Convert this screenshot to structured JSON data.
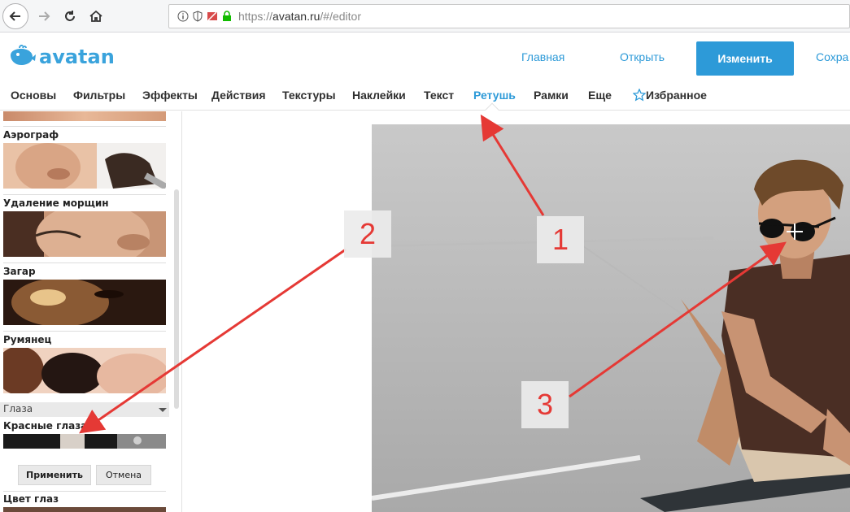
{
  "browser": {
    "url_prefix": "https://",
    "url_domain": "avatan.ru",
    "url_path": "/#/editor"
  },
  "header": {
    "logo_text": "avatan",
    "links": {
      "home": "Главная",
      "open": "Открыть",
      "save": "Сохра"
    },
    "edit_button": "Изменить"
  },
  "menu": {
    "items": [
      "Основы",
      "Фильтры",
      "Эффекты",
      "Действия",
      "Текстуры",
      "Наклейки",
      "Текст",
      "Ретушь",
      "Рамки",
      "Еще"
    ],
    "favorites": "Избранное",
    "active": "Ретушь"
  },
  "sidebar": {
    "effects": [
      "Аэрограф",
      "Удаление морщин",
      "Загар",
      "Румянец"
    ],
    "section": "Глаза",
    "selected_effect": "Красные глаза",
    "apply_button": "Применить",
    "cancel_button": "Отмена",
    "next_effect": "Цвет глаз"
  },
  "annotations": {
    "one": "1",
    "two": "2",
    "three": "3"
  },
  "colors": {
    "accent": "#2d9ad8",
    "annotation": "#e53935"
  }
}
